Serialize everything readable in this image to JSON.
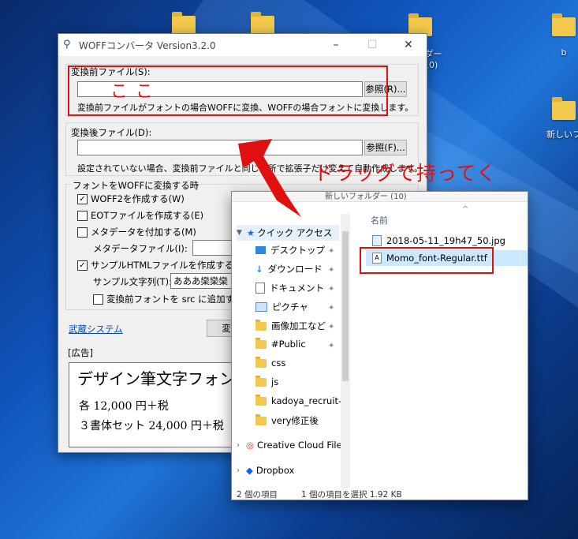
{
  "desktop": {
    "icons": [
      {
        "label": ""
      },
      {
        "label": ""
      },
      {
        "label": "ルダー (10)"
      },
      {
        "label": "b"
      },
      {
        "label": "新しいフ"
      }
    ]
  },
  "woff": {
    "title": "WOFFコンバータ Version3.2.0",
    "src_label": "変換前ファイル(S):",
    "src_value": "",
    "src_browse": "参照(R)...",
    "src_hint": "変換前ファイルがフォントの場合WOFFに変換、WOFFの場合フォントに変換します。",
    "dst_label": "変換後ファイル(D):",
    "dst_value": "",
    "dst_browse": "参照(F)...",
    "dst_hint": "設定されていない場合、変換前ファイルと同じ場所で拡張子だけ変えて自動作成します。",
    "group_label": "フォントをWOFFに変換する時",
    "opt_woff2": "WOFF2を作成する(W)",
    "opt_eot": "EOTファイルを作成する(E)",
    "opt_meta": "メタデータを付加する(M)",
    "meta_file_label": "メタデータファイル(I):",
    "opt_sample": "サンプルHTMLファイルを作成する(H)",
    "sample_text_label": "サンプル文字列(T):",
    "sample_text_value": "あああ欒欒欒",
    "opt_src": "変換前フォントを src に追加する(",
    "link": "武蔵システム",
    "convert": "変",
    "ad_label": "[広告]",
    "ad_title": "デザイン筆文字フォン",
    "ad_line1": "各 12,000 円＋税",
    "ad_line2": "３書体セット 24,000 円＋税"
  },
  "explorer": {
    "path": "新しいフォルダー (10)",
    "col_name": "名前",
    "nav": [
      {
        "label": "クイック アクセス",
        "pinned": false
      },
      {
        "label": "デスクトップ",
        "pinned": true
      },
      {
        "label": "ダウンロード",
        "pinned": true
      },
      {
        "label": "ドキュメント",
        "pinned": true
      },
      {
        "label": "ピクチャ",
        "pinned": true
      },
      {
        "label": "画像加工など",
        "pinned": true
      },
      {
        "label": "#Public",
        "pinned": true
      },
      {
        "label": "css",
        "pinned": false
      },
      {
        "label": "js",
        "pinned": false
      },
      {
        "label": "kadoya_recruit-t",
        "pinned": false
      },
      {
        "label": "very修正後",
        "pinned": false
      },
      {
        "label": "Creative Cloud File",
        "pinned": false
      },
      {
        "label": "Dropbox",
        "pinned": false
      }
    ],
    "files": [
      {
        "name": "2018-05-11_19h47_50.jpg"
      },
      {
        "name": "Momo_font-Regular.ttf"
      }
    ],
    "status_count": "2 個の項目",
    "status_selected": "1 個の項目を選択  1.92 KB"
  },
  "annotations": {
    "koko": "ここ",
    "drag": "ドラッグで持ってく",
    "color": "#e01010"
  }
}
